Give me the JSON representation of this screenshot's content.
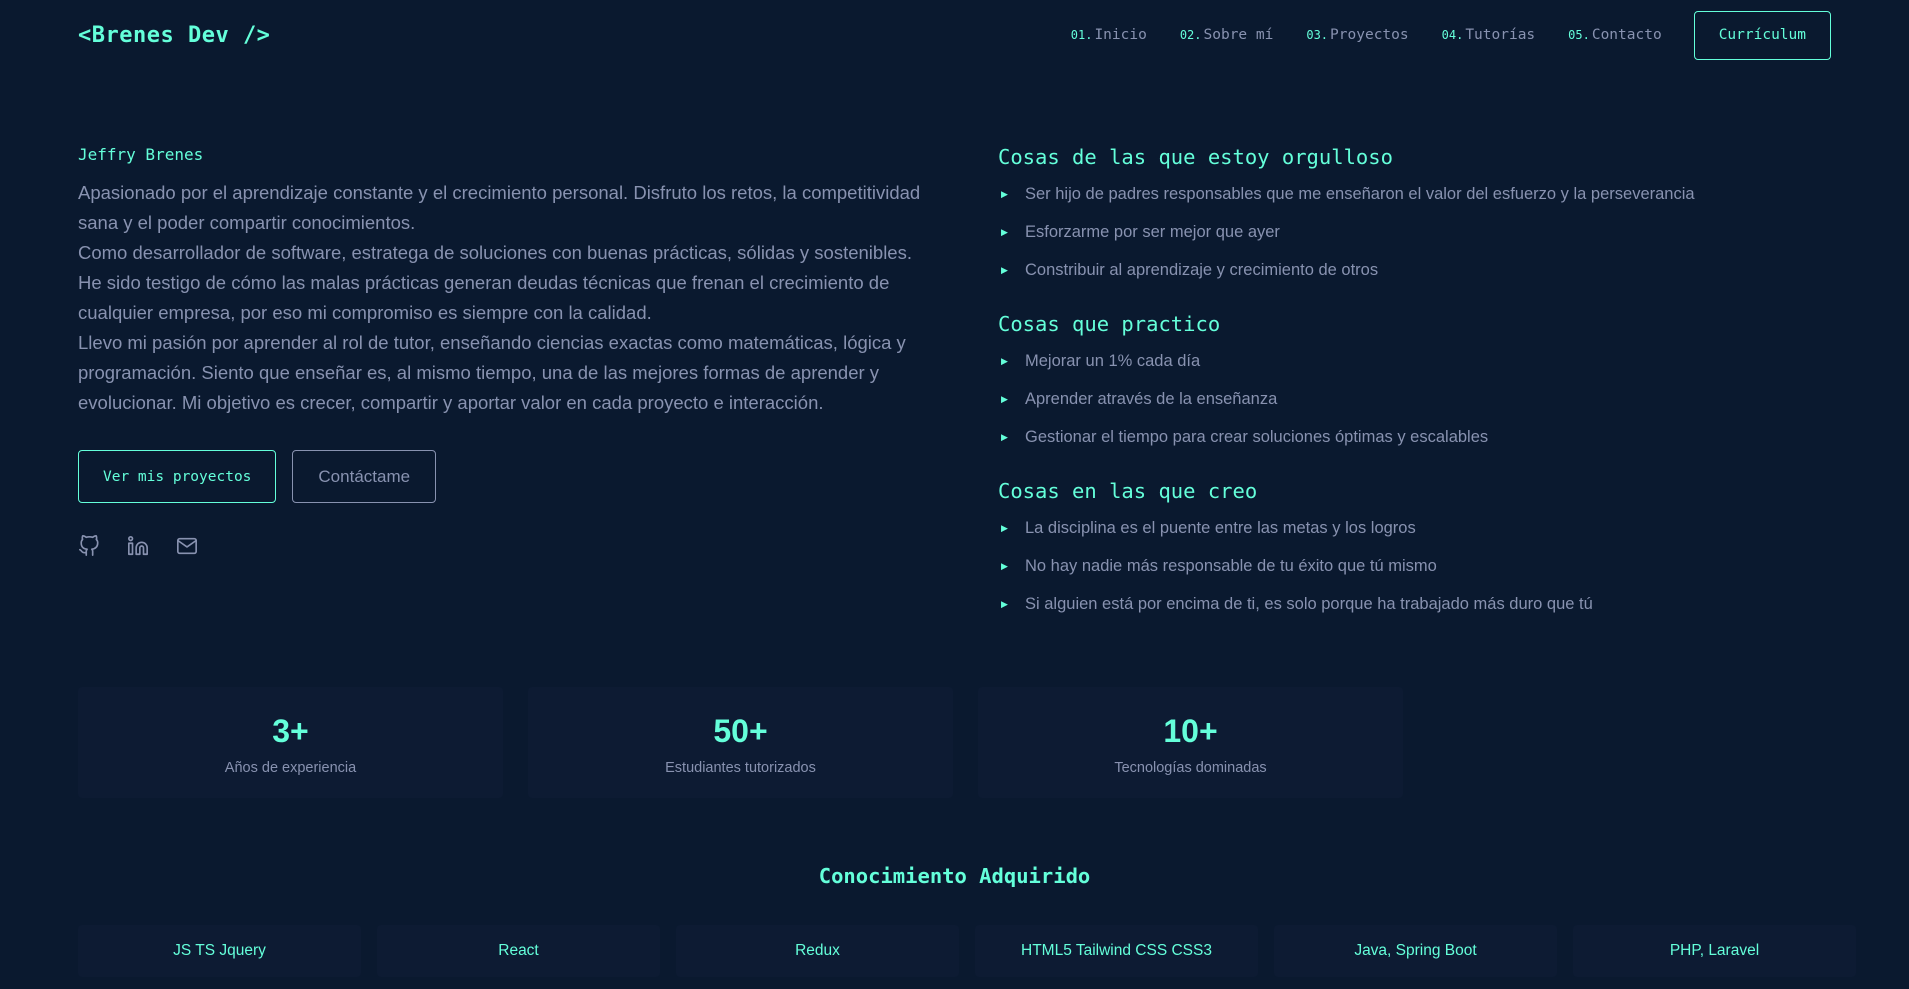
{
  "nav": {
    "logo": "<Brenes Dev />",
    "links": [
      {
        "num": "01.",
        "label": "Inicio"
      },
      {
        "num": "02.",
        "label": "Sobre mí"
      },
      {
        "num": "03.",
        "label": "Proyectos"
      },
      {
        "num": "04.",
        "label": "Tutorías"
      },
      {
        "num": "05.",
        "label": "Contacto"
      }
    ],
    "cv_label": "Currículum"
  },
  "hero": {
    "name": "Jeffry Brenes",
    "paragraphs": [
      "Apasionado por el aprendizaje constante y el crecimiento personal. Disfruto los retos, la competitividad sana y el poder compartir conocimientos.",
      "Como desarrollador de software, estratega de soluciones con buenas prácticas, sólidas y sostenibles. He sido testigo de cómo las malas prácticas generan deudas técnicas que frenan el crecimiento de cualquier empresa, por eso mi compromiso es siempre con la calidad.",
      "Llevo mi pasión por aprender al rol de tutor, enseñando ciencias exactas como matemáticas, lógica y programación. Siento que enseñar es, al mismo tiempo, una de las mejores formas de aprender y evolucionar. Mi objetivo es crecer, compartir y aportar valor en cada proyecto e interacción."
    ],
    "projects_button": "Ver mis proyectos",
    "contact_button": "Contáctame",
    "socials": [
      {
        "icon": "github-icon"
      },
      {
        "icon": "linkedin-icon"
      },
      {
        "icon": "mail-icon"
      }
    ]
  },
  "groups": [
    {
      "title": "Cosas de las que estoy orgulloso",
      "items": [
        "Ser hijo de padres responsables que me enseñaron el valor del esfuerzo y la perseverancia",
        "Esforzarme por ser mejor que ayer",
        "Constribuir al aprendizaje y crecimiento de otros"
      ]
    },
    {
      "title": "Cosas que practico",
      "items": [
        "Mejorar un 1% cada día",
        "Aprender através de la enseñanza",
        "Gestionar el tiempo para crear soluciones óptimas y escalables"
      ]
    },
    {
      "title": "Cosas en las que creo",
      "items": [
        "La disciplina es el puente entre las metas y los logros",
        "No hay nadie más responsable de tu éxito que tú mismo",
        "Si alguien está por encima de ti, es solo porque ha trabajado más duro que tú"
      ]
    }
  ],
  "stats": [
    {
      "value": "3+",
      "label": "Años de experiencia"
    },
    {
      "value": "50+",
      "label": "Estudiantes tutorizados"
    },
    {
      "value": "10+",
      "label": "Tecnologías dominadas"
    }
  ],
  "knowledge": {
    "title": "Conocimiento Adquirido",
    "skills": [
      "JS TS Jquery",
      "React",
      "Redux",
      "HTML5 Tailwind CSS CSS3",
      "Java, Spring Boot",
      "PHP, Laravel"
    ]
  },
  "colors": {
    "background": "#0a192f",
    "accent": "#64ffda",
    "text": "#8892b0",
    "card": "#0d1b33"
  }
}
